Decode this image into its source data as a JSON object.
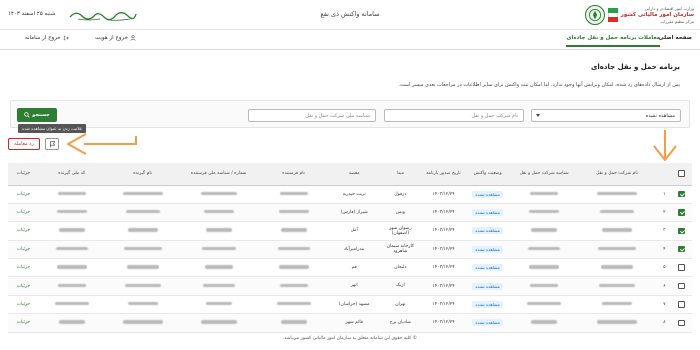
{
  "header": {
    "org_line1": "وزارت امور اقتصادی و دارایی",
    "org_name": "سازمان امور مالیاتی کشور",
    "org_line3": "مرکز تنظیم مقررات",
    "system_title": "سامانه واکنش ذی نفع",
    "date": "شنبه ۲۵ اسفند ۱۴۰۳"
  },
  "nav": {
    "home": "صفحه اصلی",
    "transport": "معاملات برنامه حمل و نقل جاده‌ای",
    "exit_identity": "خروج از هویت",
    "logout": "خروج از سامانه"
  },
  "page": {
    "heading": "برنامه حمل و نقل جاده‌ای",
    "note": "پس از ارسال داده‌های رد شده، امکان ویرایش آنها وجود ندارد. اما امکان ثبت واکنش برای سایر اطلاعات در مراجعات بعدی میسر است."
  },
  "filters": {
    "status_value": "مشاهده نشده",
    "name_placeholder": "نام شرکت حمل و نقل",
    "nid_placeholder": "شناسه ملی شرکت حمل و نقل",
    "search_label": "جستجو",
    "tooltip": "علامت زدن به عنوان مشاهده شده"
  },
  "actions": {
    "reject_label": "رد معامله"
  },
  "table": {
    "headers": [
      "",
      "",
      "نام شرکت حمل و نقل",
      "شناسه شرکت حمل و نقل",
      "وضعیت واکنش",
      "تاریخ صدور بارنامه",
      "مبدا",
      "مقصد",
      "نام فرستنده",
      "شماره / شناسه ملی فرستنده",
      "نام گیرنده",
      "کد ملی گیرنده",
      "جزئیات"
    ],
    "rows": [
      {
        "num": "۱",
        "checked": true,
        "status": "مشاهده نشده",
        "date": "۱۴۰۳/۱۲/۲۴",
        "origin": "دزفول",
        "dest": "تربت حیدریه",
        "details": "جزئیات"
      },
      {
        "num": "۲",
        "checked": true,
        "status": "مشاهده نشده",
        "date": "۱۴۰۳/۱۲/۲۴",
        "origin": "ونس",
        "dest": "شیراز (فارس)",
        "details": "جزئیات"
      },
      {
        "num": "۳",
        "checked": true,
        "status": "مشاهده نشده",
        "date": "۱۴۰۳/۱۲/۲۴",
        "origin": "رضوان شهر (اصفهان)",
        "dest": "آمل",
        "details": "جزئیات"
      },
      {
        "num": "۴",
        "checked": true,
        "status": "مشاهده نشده",
        "date": "۱۴۰۳/۱۲/۲۴",
        "origin": "کارخانه سیمان شاهرود",
        "dest": "بندرامیرآباد",
        "details": "جزئیات"
      },
      {
        "num": "۵",
        "checked": false,
        "status": "مشاهده نشده",
        "date": "۱۴۰۳/۱۲/۲۴",
        "origin": "دلیجان",
        "dest": "قم",
        "details": "جزئیات"
      },
      {
        "num": "۶",
        "checked": false,
        "status": "مشاهده نشده",
        "date": "۱۴۰۳/۱۲/۲۴",
        "origin": "ازبک",
        "dest": "ابهر",
        "details": "جزئیات"
      },
      {
        "num": "۷",
        "checked": false,
        "status": "مشاهده نشده",
        "date": "۱۴۰۳/۱۲/۲۴",
        "origin": "تهران",
        "dest": "مشهد (خراسان)",
        "details": "جزئیات"
      },
      {
        "num": "۸",
        "checked": false,
        "status": "مشاهده نشده",
        "date": "۱۴۰۳/۱۲/۲۴",
        "origin": "شادیان برج",
        "dest": "قائم شهر",
        "details": "جزئیات"
      }
    ]
  },
  "footer": {
    "copyright": "© کلیه حقوق این سامانه متعلق به سازمان امور مالیاتی کشور می‌باشد."
  },
  "colors": {
    "brand_green": "#2e7d32",
    "annotation_orange": "#f39c4a",
    "reject_red": "#c62828"
  }
}
